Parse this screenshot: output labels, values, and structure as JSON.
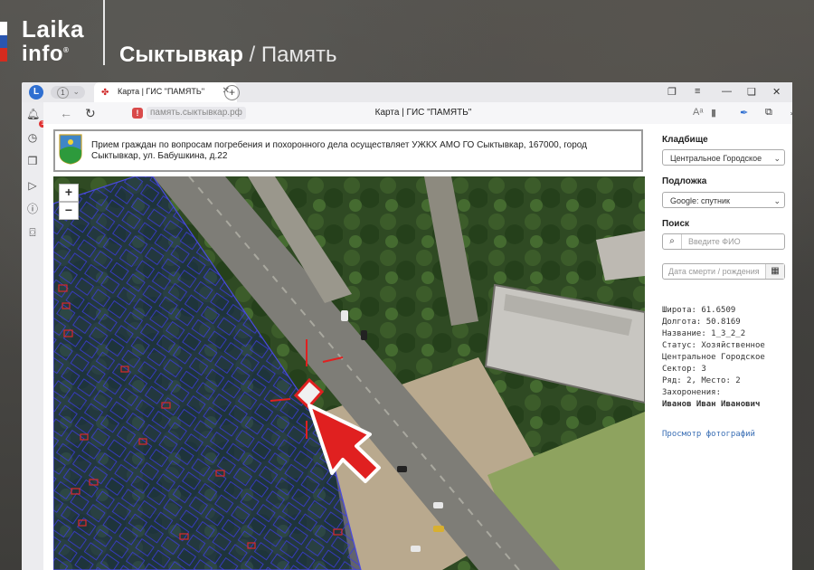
{
  "brand": {
    "logo_line1": "Laika",
    "logo_line2": "info",
    "logo_mark": "®",
    "headline_city": "Сыктывкар",
    "headline_sep": "/",
    "headline_section": "Память",
    "flag_colors": [
      "#ffffff",
      "#2a56b0",
      "#d52b1e"
    ]
  },
  "browser": {
    "avatar_letter": "L",
    "tab_group_count": "1",
    "tab_title": "Карта | ГИС \"ПАМЯТЬ\"",
    "url": "память.сыктывкар.рф",
    "page_title": "Карта | ГИС \"ПАМЯТЬ\"",
    "download_badge": "1",
    "notification_badge": "1"
  },
  "notice": {
    "text": "Прием граждан по вопросам погребения и похоронного дела осуществляет УЖКХ АМО ГО Сыктывкар, 167000, город Сыктывкар, ул. Бабушкина, д.22"
  },
  "map": {
    "zoom_in": "+",
    "zoom_out": "−"
  },
  "panel": {
    "cemetery_label": "Кладбище",
    "cemetery_value": "Центральное Городское",
    "basemap_label": "Подложка",
    "basemap_value": "Google: спутник",
    "search_label": "Поиск",
    "search_placeholder": "Введите ФИО",
    "date_placeholder": "Дата смерти / рождения",
    "info": {
      "lat": "Широта: 61.6509",
      "lon": "Долгота: 50.8169",
      "name": "Название: 1_3_2_2",
      "status": "Статус: Хозяйственное",
      "status2": "Центральное Городское",
      "sector": "Сектор: 3",
      "row": "Ряд: 2, Место: 2",
      "burials": "Захоронения:",
      "person": "Иванов Иван Иванович"
    },
    "photos_link": "Просмотр фотографий"
  },
  "colors": {
    "accent_blue": "#3b6fb5",
    "highlight_red": "#e02020",
    "plot_outline": "#3b3bd8"
  }
}
